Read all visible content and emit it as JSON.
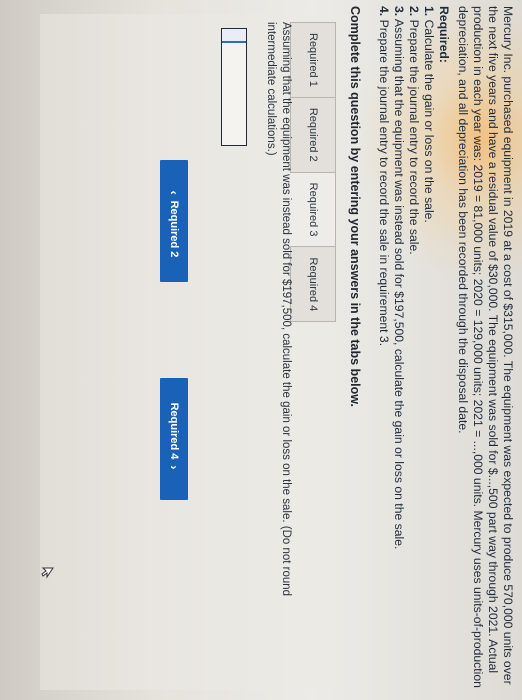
{
  "problem": {
    "intro": "Mercury Inc. purchased equipment in 2019 at a cost of $315,000. The equipment was expected to produce 570,000 units over the next five years and have a residual value of $30,000. The equipment was sold for $...,500 part way through 2021. Actual production in each year was: 2019 = 81,000 units; 2020 = 129,000 units; 2021 = ...,000 units. Mercury uses units-of-production depreciation, and all depreciation has been recorded through the disposal date.",
    "required_heading": "Required:",
    "items": [
      {
        "num": "1.",
        "text": "Calculate the gain or loss on the sale."
      },
      {
        "num": "2.",
        "text": "Prepare the journal entry to record the sale."
      },
      {
        "num": "3.",
        "text": "Assuming that the equipment was instead sold for $197,500, calculate the gain or loss on the sale."
      },
      {
        "num": "4.",
        "text": "Prepare the journal entry to record the sale in requirement 3."
      }
    ]
  },
  "instruction": "Complete this question by entering your answers in the tabs below.",
  "tabs": [
    "Required 1",
    "Required 2",
    "Required 3",
    "Required 4"
  ],
  "question": "Assuming that the equipment was instead sold for $197,500, calculate the gain or loss on the sale. (Do not round intermediate calculations.)",
  "answer": {
    "value": ""
  },
  "nav": {
    "prev_label": "Required 2",
    "next_label": "Required 4",
    "prev_icon": "chevron-left-icon",
    "next_icon": "chevron-right-icon"
  }
}
